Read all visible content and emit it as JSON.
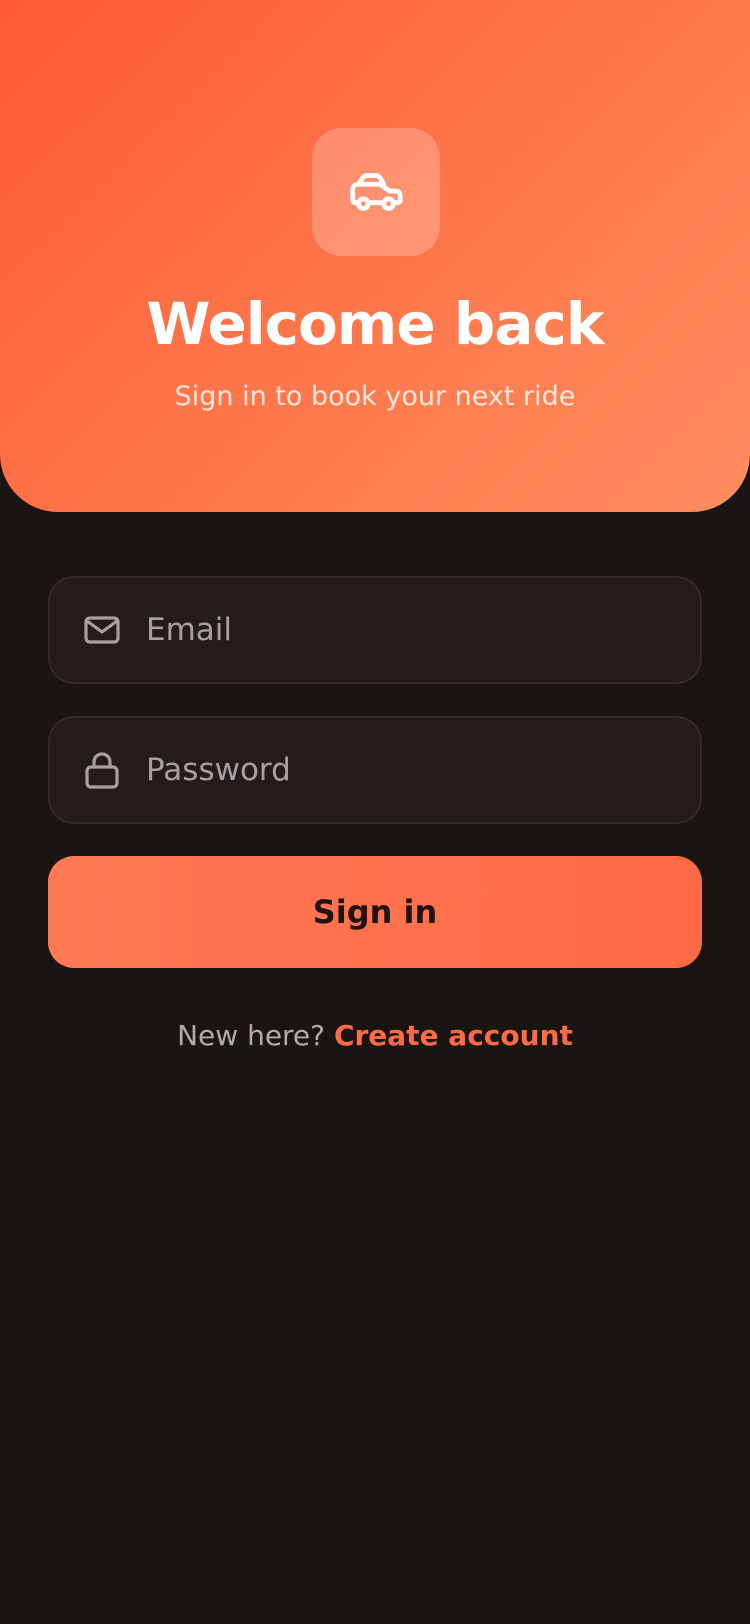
{
  "header": {
    "logo_icon": "car-icon",
    "title": "Welcome back",
    "subtitle": "Sign in to book your next ride"
  },
  "form": {
    "email": {
      "icon": "mail-icon",
      "placeholder": "Email",
      "value": ""
    },
    "password": {
      "icon": "lock-icon",
      "placeholder": "Password",
      "value": ""
    },
    "signin_label": "Sign in"
  },
  "footer": {
    "prompt": "New here?",
    "link_label": "Create account"
  },
  "colors": {
    "accent": "#ff6b45",
    "background": "#1a1412",
    "field_bg": "#251c1a"
  }
}
